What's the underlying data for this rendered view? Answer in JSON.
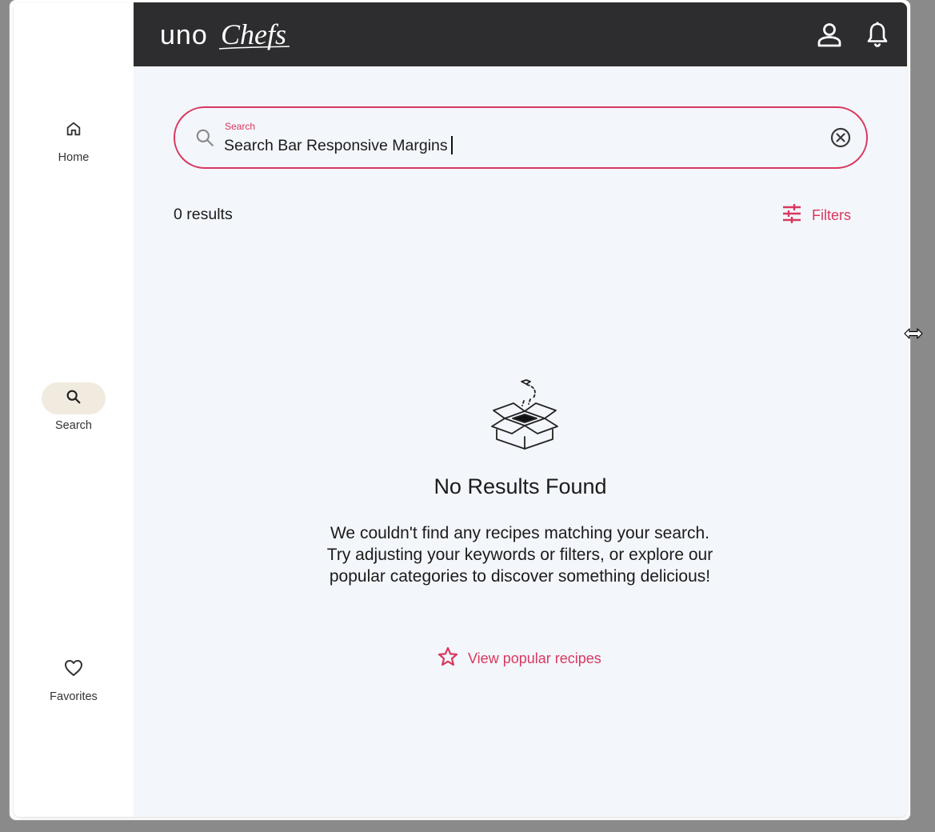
{
  "app": {
    "logo_text_left": "uno",
    "logo_text_right": "Chefs"
  },
  "nav": {
    "items": [
      {
        "label": "Home",
        "icon": "home-icon",
        "active": false
      },
      {
        "label": "Search",
        "icon": "search-icon",
        "active": true
      },
      {
        "label": "Favorites",
        "icon": "heart-icon",
        "active": false
      }
    ]
  },
  "topbar": {
    "icons": [
      "user-icon",
      "bell-icon"
    ]
  },
  "search": {
    "label": "Search",
    "value": "Search Bar Responsive Margins",
    "clear_icon": "close-circle-icon"
  },
  "results": {
    "count_text": "0 results",
    "filters_label": "Filters"
  },
  "empty_state": {
    "illustration": "empty-box-icon",
    "title": "No Results Found",
    "body": "We couldn't find any recipes matching your search. Try adjusting your keywords or filters, or explore our popular categories to discover something delicious!",
    "link_label": "View popular recipes",
    "link_icon": "star-icon"
  },
  "colors": {
    "accent": "#d9385e",
    "topbar": "#2d2d2f",
    "background": "#f3f6fb",
    "active_nav": "#f1ebdf"
  }
}
